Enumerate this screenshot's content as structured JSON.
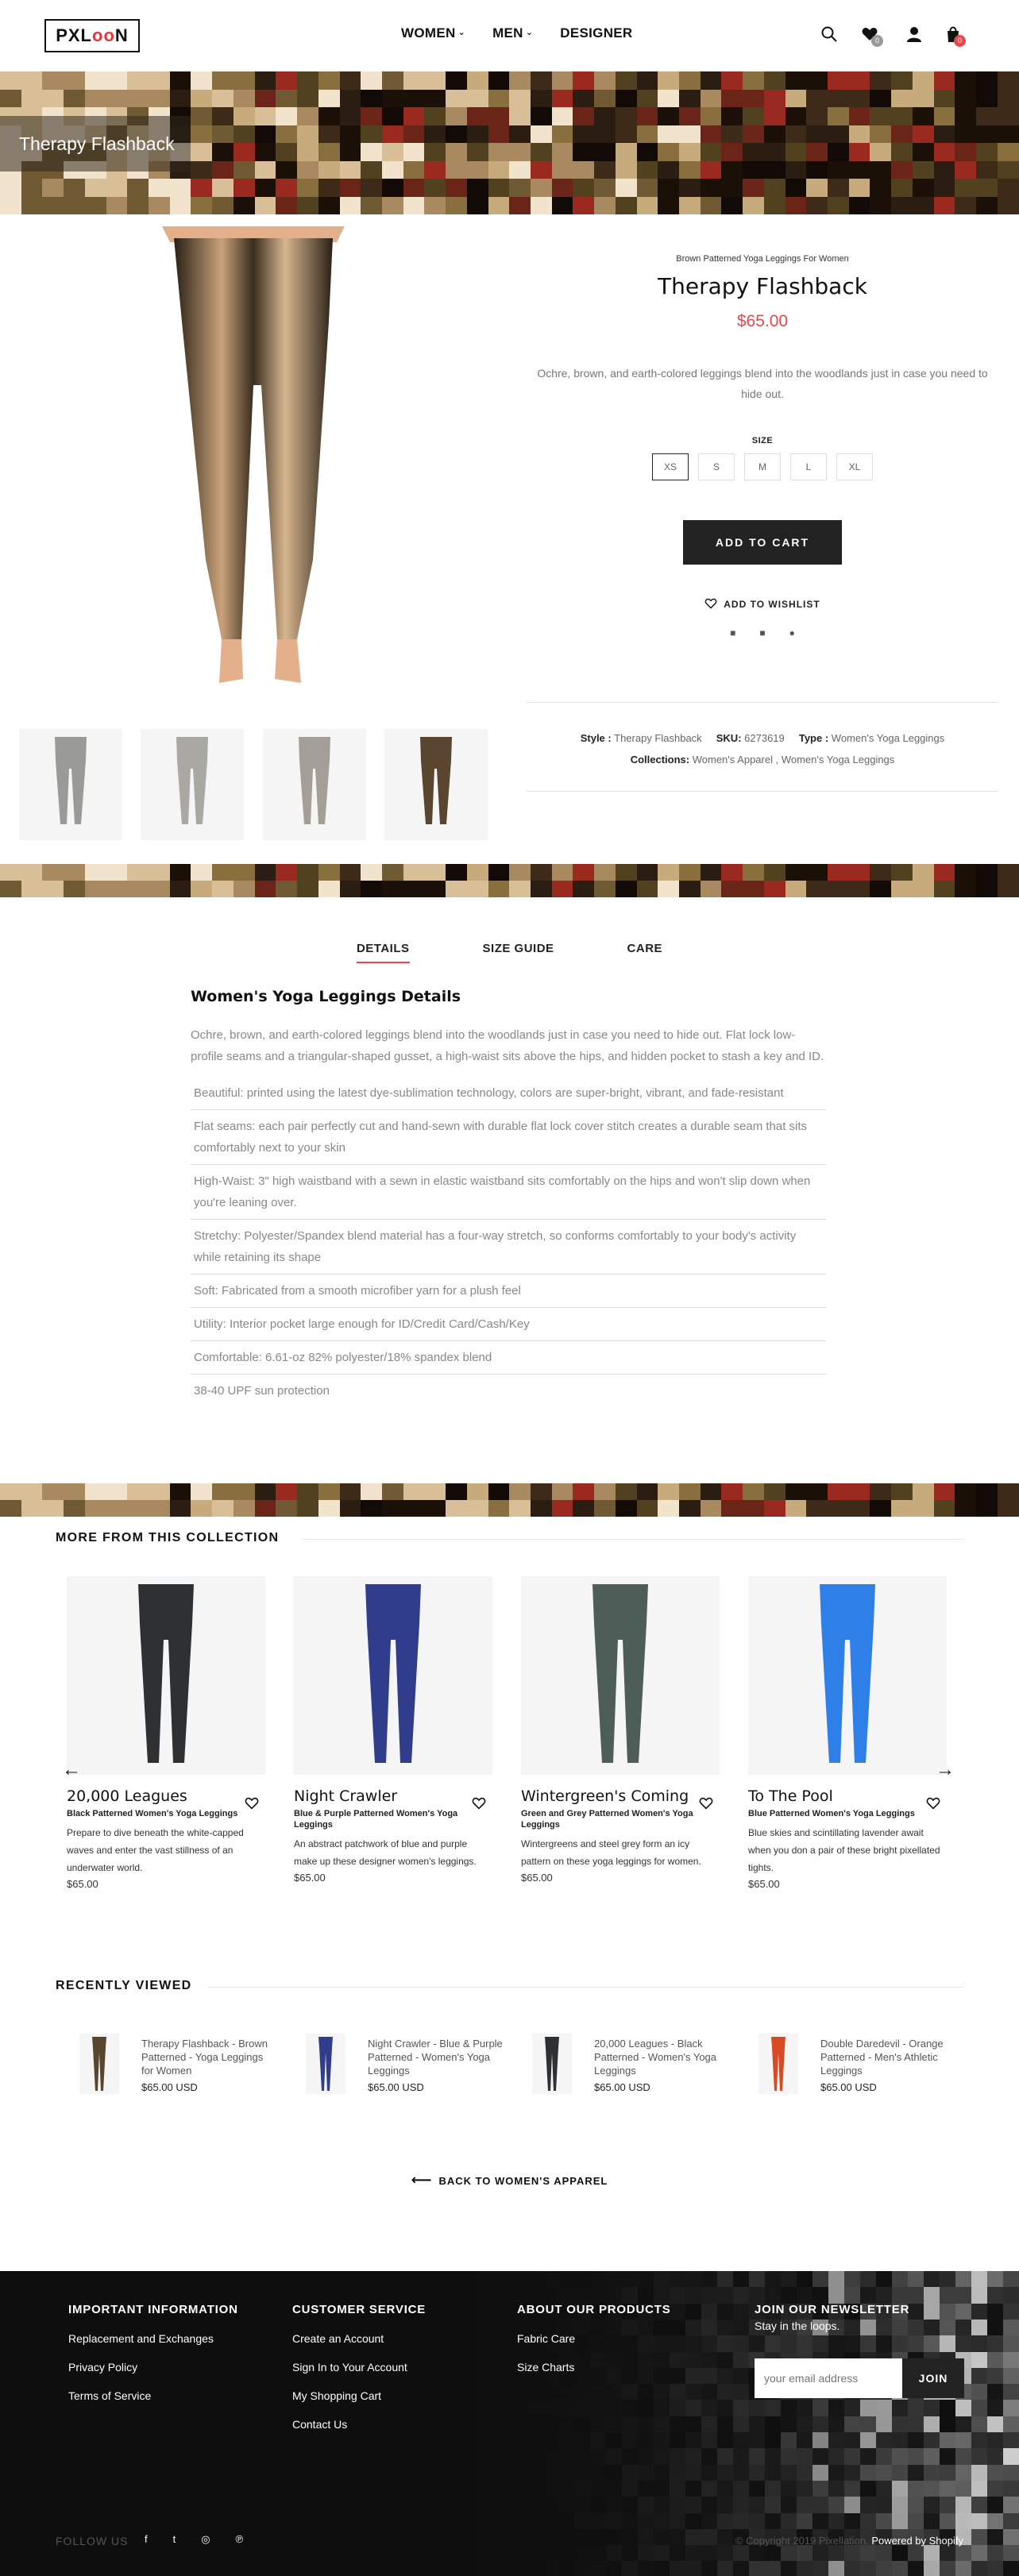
{
  "header": {
    "logo_prefix": "PXL",
    "logo_oo": "oo",
    "logo_suffix": "N",
    "nav": [
      "WOMEN",
      "MEN",
      "DESIGNER"
    ],
    "wishlist_count": "0",
    "cart_count": "0",
    "accent": "#e5484d"
  },
  "hero": {
    "title": "Therapy Flashback"
  },
  "product": {
    "subtitle": "Brown Patterned Yoga Leggings For Women",
    "title": "Therapy Flashback",
    "price": "$65.00",
    "description": "Ochre, brown, and earth-colored leggings blend into the woodlands just in case you need to hide out.",
    "size_label": "SIZE",
    "sizes": [
      "XS",
      "S",
      "M",
      "L",
      "XL"
    ],
    "selected_size": "XS",
    "add_to_cart": "ADD TO CART",
    "wishlist": "ADD TO WISHLIST",
    "share_icons": [
      "facebook-icon",
      "twitter-icon",
      "pinterest-icon"
    ],
    "meta": {
      "style_label": "Style :",
      "style_value": "Therapy Flashback",
      "sku_label": "SKU:",
      "sku_value": "6273619",
      "type_label": "Type :",
      "type_value": "Women's Yoga Leggings",
      "collections_label": "Collections:",
      "collections_value": "Women's Apparel",
      "collections_sep": " , ",
      "collections_value2": "Women's Yoga Leggings"
    }
  },
  "tabs": [
    "DETAILS",
    "SIZE GUIDE",
    "CARE"
  ],
  "details": {
    "title": "Women's Yoga Leggings Details",
    "intro": "Ochre, brown, and earth-colored leggings blend into the woodlands just in case you need to hide out. Flat lock low-profile seams and a triangular-shaped gusset, a high-waist sits above the hips, and hidden pocket to stash a key and ID.",
    "features": [
      "Beautiful: printed using the latest dye-sublimation technology, colors are super-bright, vibrant, and fade-resistant",
      "Flat seams: each pair perfectly cut and hand-sewn with durable flat lock cover stitch creates a durable seam that sits comfortably next to your skin",
      "High-Waist: 3\" high waistband with a sewn in elastic waistband sits comfortably on the hips and won't slip down when you're leaning over.",
      "Stretchy: Polyester/Spandex blend material has a four-way stretch, so conforms comfortably to your body's activity while retaining its shape",
      "Soft: Fabricated from a smooth microfiber yarn for a plush feel",
      "Utility: Interior pocket large enough for ID/Credit Card/Cash/Key",
      "Comfortable: 6.61-oz 82% polyester/18% spandex blend",
      "38-40 UPF sun protection"
    ]
  },
  "collection": {
    "title": "MORE FROM THIS COLLECTION",
    "items": [
      {
        "name": "20,000 Leagues",
        "sub": "Black Patterned Women's Yoga Leggings",
        "desc": "Prepare to dive beneath the white-capped waves and enter the vast stillness of an underwater world.",
        "price": "$65.00",
        "color": "#2d3134"
      },
      {
        "name": "Night Crawler",
        "sub": "Blue & Purple Patterned Women's Yoga Leggings",
        "desc": "An abstract patchwork of blue and purple make up these designer women's leggings.",
        "price": "$65.00",
        "color": "#2f3d8c"
      },
      {
        "name": "Wintergreen's Coming",
        "sub": "Green and Grey Patterned Women's Yoga Leggings",
        "desc": "Wintergreens and steel grey form an icy pattern on these yoga leggings for women.",
        "price": "$65.00",
        "color": "#4d5d58"
      },
      {
        "name": "To The Pool",
        "sub": "Blue Patterned Women's Yoga Leggings",
        "desc": "Blue skies and scintillating lavender await when you don a pair of these bright pixellated tights.",
        "price": "$65.00",
        "color": "#2f7fe8"
      }
    ]
  },
  "recently_viewed": {
    "title": "RECENTLY VIEWED",
    "items": [
      {
        "name": "Therapy Flashback - Brown Patterned - Yoga Leggings for Women",
        "price": "$65.00 USD",
        "color": "#5a4630"
      },
      {
        "name": "Night Crawler - Blue & Purple Patterned - Women's Yoga Leggings",
        "price": "$65.00 USD",
        "color": "#2f3d8c"
      },
      {
        "name": "20,000 Leagues - Black Patterned - Women's Yoga Leggings",
        "price": "$65.00 USD",
        "color": "#2d3134"
      },
      {
        "name": "Double Daredevil - Orange Patterned - Men's Athletic Leggings",
        "price": "$65.00 USD",
        "color": "#d84a24"
      }
    ]
  },
  "back_link": "BACK TO WOMEN'S APPAREL",
  "footer": {
    "col1": {
      "title": "IMPORTANT INFORMATION",
      "links": [
        "Replacement and Exchanges",
        "Privacy Policy",
        "Terms of Service"
      ]
    },
    "col2": {
      "title": "CUSTOMER SERVICE",
      "links": [
        "Create an Account",
        "Sign In to Your Account",
        "My Shopping Cart",
        "Contact Us"
      ]
    },
    "col3": {
      "title": "ABOUT OUR PRODUCTS",
      "links": [
        "Fabric Care",
        "Size Charts"
      ]
    },
    "newsletter": {
      "title": "JOIN OUR NEWSLETTER",
      "sub": "Stay in the loops.",
      "placeholder": "your email address",
      "join": "JOIN"
    },
    "follow": "FOLLOW US",
    "copyright": "© Copyright 2019 Pixellation.",
    "powered": "Powered by Shopify"
  }
}
